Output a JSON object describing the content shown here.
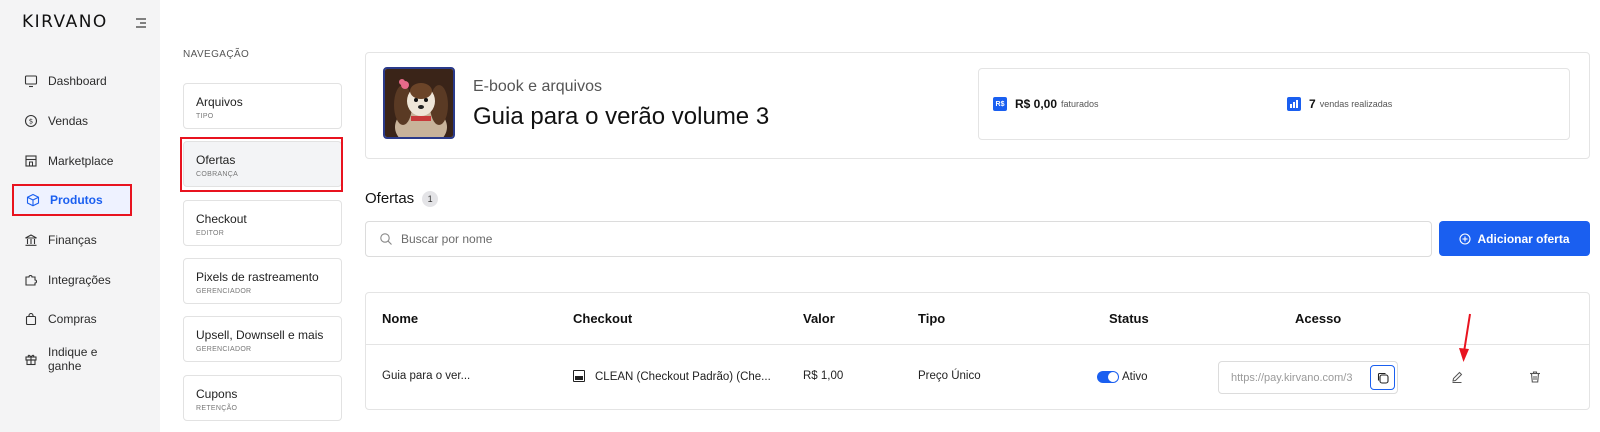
{
  "app": {
    "logo": "KIRVANO"
  },
  "sidebar": {
    "items": [
      {
        "label": "Dashboard",
        "icon": "monitor-icon"
      },
      {
        "label": "Vendas",
        "icon": "dollar-circle-icon"
      },
      {
        "label": "Marketplace",
        "icon": "store-icon"
      },
      {
        "label": "Produtos",
        "icon": "box-icon",
        "active": true
      },
      {
        "label": "Finanças",
        "icon": "bank-icon"
      },
      {
        "label": "Integrações",
        "icon": "puzzle-icon"
      },
      {
        "label": "Compras",
        "icon": "shopping-bag-icon"
      },
      {
        "label": "Indique e ganhe",
        "icon": "gift-icon"
      }
    ]
  },
  "subnav": {
    "title": "NAVEGAÇÃO",
    "items": [
      {
        "label": "Arquivos",
        "sub": "TIPO"
      },
      {
        "label": "Ofertas",
        "sub": "COBRANÇA",
        "active": true
      },
      {
        "label": "Checkout",
        "sub": "EDITOR"
      },
      {
        "label": "Pixels de rastreamento",
        "sub": "GERENCIADOR"
      },
      {
        "label": "Upsell, Downsell e mais",
        "sub": "GERENCIADOR"
      },
      {
        "label": "Cupons",
        "sub": "RETENÇÃO"
      }
    ]
  },
  "product": {
    "type": "E-book e arquivos",
    "name": "Guia para o verão volume 3",
    "stats": [
      {
        "icon_text": "R$",
        "value": "R$ 0,00",
        "desc": "faturados"
      },
      {
        "icon_text": "▮",
        "value": "7",
        "desc": "vendas realizadas"
      }
    ]
  },
  "offers": {
    "title": "Ofertas",
    "count": "1",
    "search_placeholder": "Buscar por nome",
    "add_button": "Adicionar oferta"
  },
  "table": {
    "headers": [
      "Nome",
      "Checkout",
      "Valor",
      "Tipo",
      "Status",
      "Acesso"
    ],
    "rows": [
      {
        "name": "Guia para o ver...",
        "checkout": "CLEAN (Checkout Padrão) (Che...",
        "value": "R$ 1,00",
        "type": "Preço Único",
        "status": "Ativo",
        "access": "https://pay.kirvano.com/3"
      }
    ]
  },
  "colors": {
    "accent": "#1a5ff0",
    "highlight": "#e8131f",
    "sidebar_bg": "#f4f4f5"
  }
}
